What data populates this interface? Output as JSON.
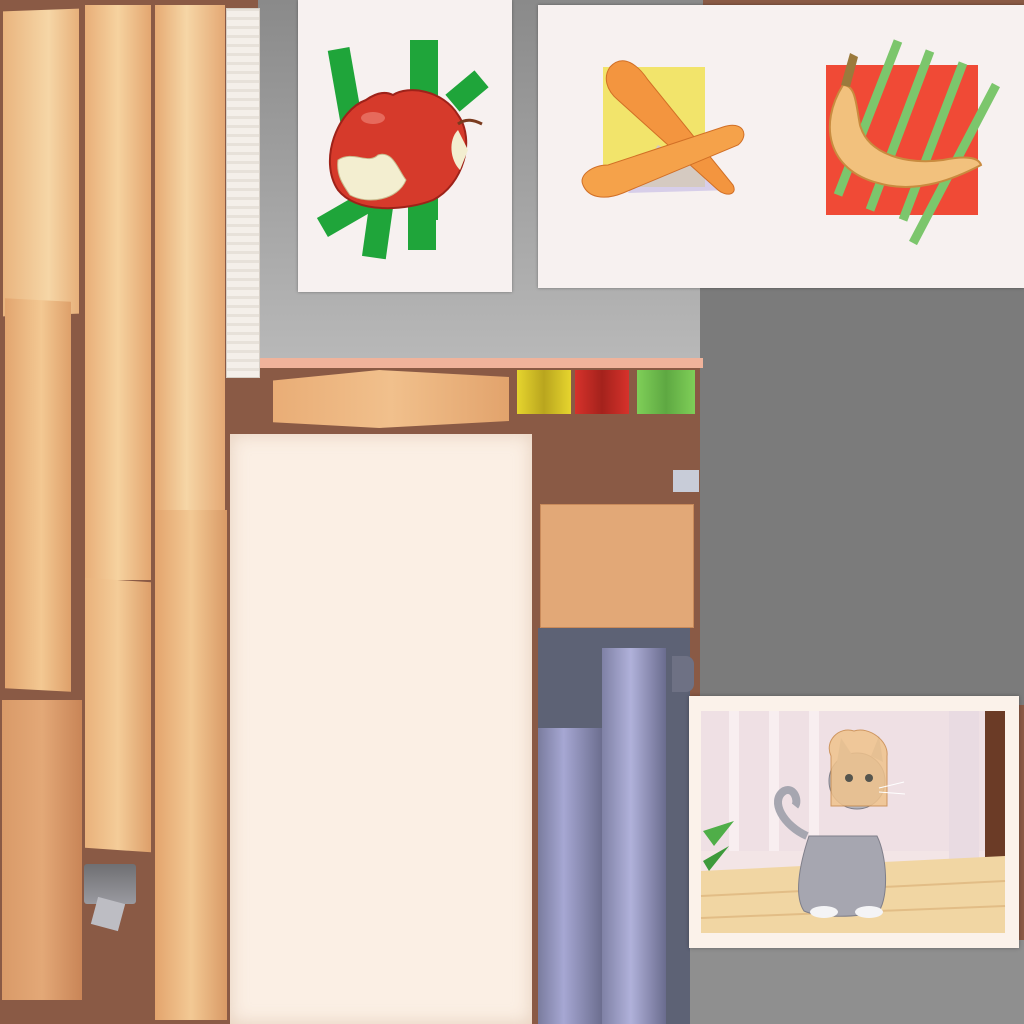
{
  "texture": {
    "kind": "game-texture-atlas",
    "background_color": "#8a5a45",
    "gray_region_color": "#7b7b7b",
    "wood_colors": [
      "#f3c892",
      "#e9b47e",
      "#d99a68",
      "#c98557"
    ],
    "paper_color": "#fbefe4",
    "note_color": "#e2a877"
  },
  "cards": {
    "apple_card": {
      "icon": "bitten-apple-icon",
      "accent_color": "#1fa53a",
      "fruit_color": "#d63a2b"
    },
    "vegetables_card": {
      "carrot": {
        "icon": "carrots-icon",
        "accent_color": "#f2e46b",
        "fruit_color": "#f3953f"
      },
      "banana": {
        "icon": "banana-icon",
        "accent_color": "#f04a36",
        "stripe_color": "#7cc66c",
        "fruit_color": "#f2c17d"
      }
    }
  },
  "swatches": [
    {
      "name": "yellow-swatch",
      "color": "#e6d52e"
    },
    {
      "name": "red-swatch",
      "color": "#d6322b"
    },
    {
      "name": "green-swatch",
      "color": "#7fcf58"
    }
  ],
  "metal_panel": {
    "color": "#5d6275",
    "highlight": "#a6a7d3"
  },
  "photo": {
    "subject": "cat-with-bread-photo",
    "frame_color": "#fbf2ea",
    "cat_color": "#a6a6b0",
    "bread_color": "#f0c38c",
    "floor_color": "#f1d6a3"
  }
}
